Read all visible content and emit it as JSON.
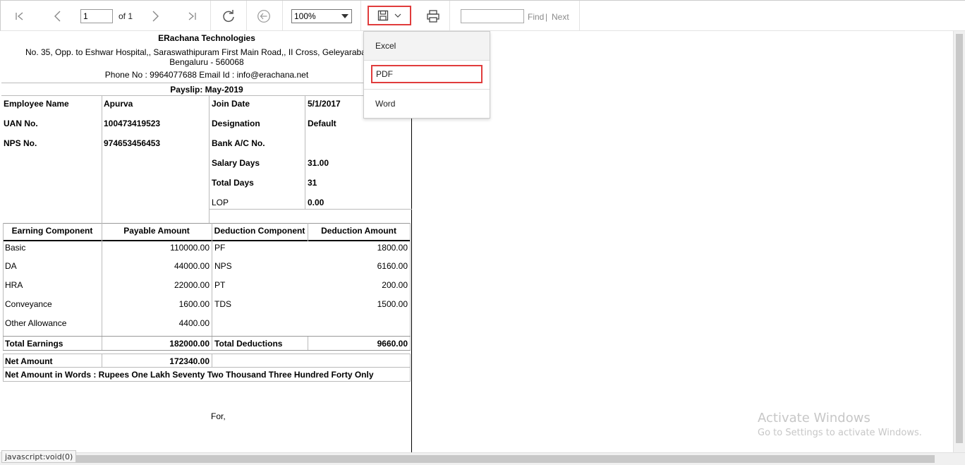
{
  "toolbar": {
    "page_current": "1",
    "page_of": "of 1",
    "zoom": "100%",
    "find_placeholder": "",
    "find_label": "Find",
    "separator": "|",
    "next_label": "Next"
  },
  "export_menu": {
    "items": [
      "Excel",
      "PDF",
      "Word"
    ]
  },
  "report": {
    "company_name": "ERachana Technologies",
    "address_line1": "No. 35, Opp. to Eshwar Hospital,, Saraswathipuram First Main Road,, II Cross, Geleyaraba",
    "address_line2": "Bengaluru - 560068",
    "contact": "Phone No : 9964077688  Email Id : info@erachana.net",
    "title": "Payslip: May-2019",
    "info_left": [
      {
        "label": "Employee Name",
        "value": "Apurva"
      },
      {
        "label": "UAN No.",
        "value": "100473419523"
      },
      {
        "label": "NPS No.",
        "value": "974653456453"
      }
    ],
    "info_right": [
      {
        "label": "Join Date",
        "value": "5/1/2017"
      },
      {
        "label": "Designation",
        "value": "Default"
      },
      {
        "label": "Bank A/C No.",
        "value": ""
      },
      {
        "label": "Salary Days",
        "value": "31.00"
      },
      {
        "label": "Total Days",
        "value": "31"
      },
      {
        "label": "LOP",
        "value": "0.00"
      }
    ],
    "table_headers": [
      "Earning Component",
      "Payable Amount",
      "Deduction Component",
      "Deduction Amount"
    ],
    "earnings": [
      {
        "name": "Basic",
        "amount": "110000.00"
      },
      {
        "name": "DA",
        "amount": "44000.00"
      },
      {
        "name": "HRA",
        "amount": "22000.00"
      },
      {
        "name": "Conveyance",
        "amount": "1600.00"
      },
      {
        "name": "Other Allowance",
        "amount": "4400.00"
      }
    ],
    "deductions": [
      {
        "name": "PF",
        "amount": "1800.00"
      },
      {
        "name": "NPS",
        "amount": "6160.00"
      },
      {
        "name": "PT",
        "amount": "200.00"
      },
      {
        "name": "TDS",
        "amount": "1500.00"
      }
    ],
    "total_earnings_label": "Total Earnings",
    "total_earnings": "182000.00",
    "total_deductions_label": "Total Deductions",
    "total_deductions": "9660.00",
    "net_amount_label": "Net Amount",
    "net_amount": "172340.00",
    "net_words": "Net Amount in Words : Rupees One Lakh Seventy Two Thousand Three Hundred Forty Only",
    "for_label": "For,"
  },
  "watermark": {
    "line1": "Activate Windows",
    "line2": "Go to Settings to activate Windows."
  },
  "status_bar": "javascript:void(0)"
}
